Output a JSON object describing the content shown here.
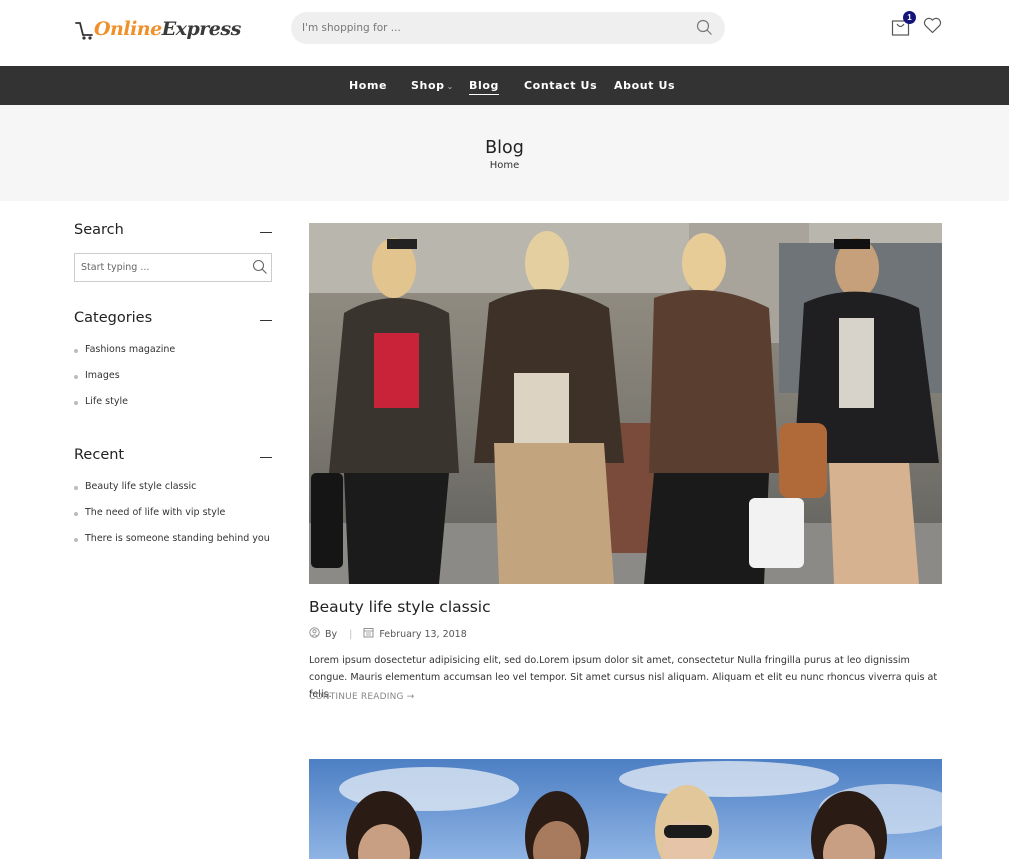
{
  "header": {
    "logo": {
      "part1": "Online",
      "part2": "Express"
    },
    "search": {
      "placeholder": "I'm shopping for ..."
    },
    "cart": {
      "count": "1"
    }
  },
  "nav": {
    "items": [
      {
        "label": "Home"
      },
      {
        "label": "Shop"
      },
      {
        "label": "Blog",
        "active": true
      },
      {
        "label": "Contact Us"
      },
      {
        "label": "About Us"
      }
    ]
  },
  "page": {
    "title": "Blog",
    "breadcrumb": "Home"
  },
  "sidebar": {
    "search": {
      "title": "Search",
      "placeholder": "Start typing ..."
    },
    "categories": {
      "title": "Categories",
      "items": [
        "Fashions magazine",
        "Images",
        "Life style"
      ]
    },
    "recent": {
      "title": "Recent",
      "items": [
        "Beauty life style classic",
        "The need of life with vip style",
        "There is someone standing behind you"
      ]
    }
  },
  "post": {
    "title": "Beauty life style classic",
    "author_label": "By",
    "date": "February 13, 2018",
    "excerpt": "Lorem ipsum dosectetur adipisicing elit, sed do.Lorem ipsum dolor sit amet, consectetur Nulla fringilla purus at leo dignissim congue. Mauris elementum accumsan leo vel tempor. Sit amet cursus nisl aliquam. Aliquam et elit eu nunc rhoncus viverra quis at felis.",
    "more": "CONTINUE READING →"
  },
  "colors": {
    "accent_orange": "#f0902a",
    "nav_bg": "#333333",
    "band_bg": "#f6f6f6",
    "badge": "#13157a"
  }
}
